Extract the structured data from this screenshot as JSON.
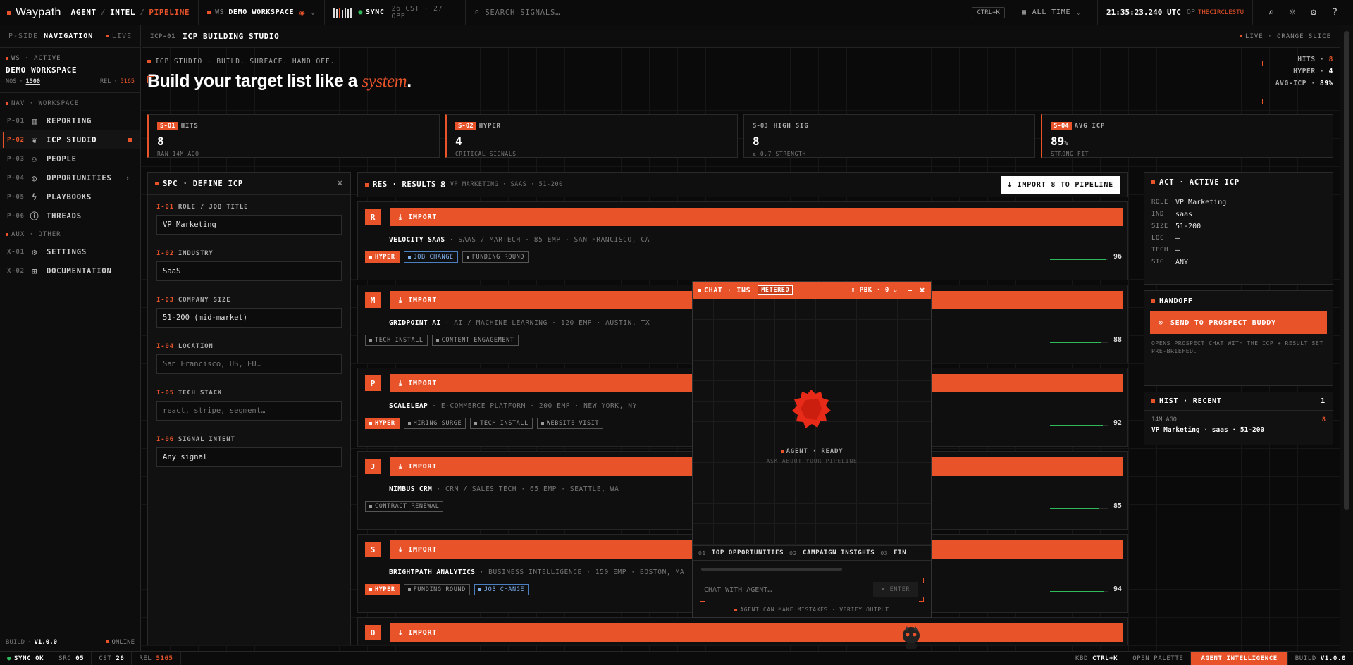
{
  "topbar": {
    "logo": "Waypath",
    "crumbs": [
      "AGENT",
      "INTEL",
      "PIPELINE"
    ],
    "workspace_prefix": "WS",
    "workspace": "DEMO WORKSPACE",
    "sync_label": "SYNC",
    "sync_stats": "26 CST · 27 OPP",
    "search_placeholder": "SEARCH SIGNALS…",
    "shortcut": "CTRL+K",
    "range": "ALL TIME",
    "clock": "21:35:23.240 UTC",
    "op_label": "OP",
    "op_user": "THECIRCLESTU"
  },
  "sidebar": {
    "head_code": "P-SIDE",
    "head_title": "NAVIGATION",
    "head_status": "LIVE",
    "ws_label": "WS · ACTIVE",
    "ws_name": "DEMO WORKSPACE",
    "nos_label": "NOS",
    "nos_value": "1500",
    "rel_label": "REL",
    "rel_value": "5165",
    "group_main": "NAV · WORKSPACE",
    "items": [
      {
        "code": "P-01",
        "label": "REPORTING",
        "icon": "bar-chart-icon"
      },
      {
        "code": "P-02",
        "label": "ICP STUDIO",
        "icon": "leaf-icon"
      },
      {
        "code": "P-03",
        "label": "PEOPLE",
        "icon": "people-icon"
      },
      {
        "code": "P-04",
        "label": "OPPORTUNITIES",
        "icon": "target-icon"
      },
      {
        "code": "P-05",
        "label": "PLAYBOOKS",
        "icon": "bolt-icon"
      },
      {
        "code": "P-06",
        "label": "THREADS",
        "icon": "info-icon"
      }
    ],
    "group_aux": "AUX · OTHER",
    "aux_items": [
      {
        "code": "X-01",
        "label": "SETTINGS",
        "icon": "gear-icon"
      },
      {
        "code": "X-02",
        "label": "DOCUMENTATION",
        "icon": "book-icon"
      }
    ],
    "build_label": "BUILD",
    "build_value": "V1.0.0",
    "online": "ONLINE"
  },
  "page": {
    "code": "ICP-01",
    "title": "ICP BUILDING STUDIO",
    "live": "LIVE · ORANGE SLICE",
    "kicker": "ICP STUDIO · BUILD. SURFACE. HAND OFF.",
    "hero_main": "Build your target list like a ",
    "hero_em": "system",
    "hero_end": ".",
    "mini": [
      {
        "k": "HITS",
        "v": "8"
      },
      {
        "k": "HYPER",
        "v": "4"
      },
      {
        "k": "AVG-ICP",
        "v": "89%"
      }
    ]
  },
  "stats": [
    {
      "code": "S-01",
      "label": "HITS",
      "value": "8",
      "sub": "RAN 14M AGO"
    },
    {
      "code": "S-02",
      "label": "HYPER",
      "value": "4",
      "sub": "CRITICAL SIGNALS"
    },
    {
      "code": "S-03",
      "label": "HIGH SIG",
      "value": "8",
      "sub": "≥ 0.7 STRENGTH"
    },
    {
      "code": "S-04",
      "label": "AVG ICP",
      "value": "89",
      "unit": "%",
      "sub": "STRONG FIT"
    }
  ],
  "define": {
    "title": "SPC · DEFINE ICP",
    "fields": [
      {
        "code": "I-01",
        "label": "ROLE / JOB TITLE",
        "value": "VP Marketing",
        "placeholder": ""
      },
      {
        "code": "I-02",
        "label": "INDUSTRY",
        "value": "SaaS",
        "placeholder": ""
      },
      {
        "code": "I-03",
        "label": "COMPANY SIZE",
        "value": "51-200 (mid-market)",
        "placeholder": ""
      },
      {
        "code": "I-04",
        "label": "LOCATION",
        "value": "",
        "placeholder": "San Francisco, US, EU…"
      },
      {
        "code": "I-05",
        "label": "TECH STACK",
        "value": "",
        "placeholder": "react, stripe, segment…"
      },
      {
        "code": "I-06",
        "label": "SIGNAL INTENT",
        "value": "Any signal",
        "placeholder": ""
      }
    ]
  },
  "results": {
    "title": "RES · RESULTS",
    "count": "8",
    "filter": "VP MARKETING · SAAS · 51-200",
    "import_all": "IMPORT 8 TO PIPELINE",
    "import_label": "IMPORT",
    "cards": [
      {
        "initial": "R",
        "name": "VELOCITY SAAS",
        "meta": "· SAAS / MARTECH · 85 EMP · SAN FRANCISCO, CA",
        "tags": [
          {
            "t": "HYPER",
            "k": "hyper"
          },
          {
            "t": "JOB CHANGE",
            "k": "blue"
          },
          {
            "t": "FUNDING ROUND",
            "k": "grey"
          }
        ],
        "score": 96
      },
      {
        "initial": "M",
        "name": "GRIDPOINT AI",
        "meta": "· AI / MACHINE LEARNING · 120 EMP · AUSTIN, TX",
        "tags": [
          {
            "t": "TECH INSTALL",
            "k": "grey"
          },
          {
            "t": "CONTENT ENGAGEMENT",
            "k": "grey"
          }
        ],
        "score": 88
      },
      {
        "initial": "P",
        "name": "SCALELEAP",
        "meta": "· E-COMMERCE PLATFORM · 200 EMP · NEW YORK, NY",
        "tags": [
          {
            "t": "HYPER",
            "k": "hyper"
          },
          {
            "t": "HIRING SURGE",
            "k": "grey"
          },
          {
            "t": "TECH INSTALL",
            "k": "grey"
          },
          {
            "t": "WEBSITE VISIT",
            "k": "grey"
          }
        ],
        "score": 92
      },
      {
        "initial": "J",
        "name": "NIMBUS CRM",
        "meta": "· CRM / SALES TECH · 65 EMP · SEATTLE, WA",
        "tags": [
          {
            "t": "CONTRACT RENEWAL",
            "k": "grey"
          }
        ],
        "score": 85
      },
      {
        "initial": "S",
        "name": "BRIGHTPATH ANALYTICS",
        "meta": "· BUSINESS INTELLIGENCE · 150 EMP · BOSTON, MA",
        "tags": [
          {
            "t": "HYPER",
            "k": "hyper"
          },
          {
            "t": "FUNDING ROUND",
            "k": "grey"
          },
          {
            "t": "JOB CHANGE",
            "k": "blue"
          }
        ],
        "score": 94
      },
      {
        "initial": "D",
        "name": "",
        "meta": "",
        "tags": [],
        "score": null
      }
    ]
  },
  "active": {
    "title": "ACT · ACTIVE ICP",
    "rows": [
      {
        "k": "ROLE",
        "v": "VP Marketing"
      },
      {
        "k": "IND",
        "v": "saas"
      },
      {
        "k": "SIZE",
        "v": "51-200"
      },
      {
        "k": "LOC",
        "v": "—"
      },
      {
        "k": "TECH",
        "v": "—"
      },
      {
        "k": "SIG",
        "v": "ANY"
      }
    ],
    "handoff_title": "HANDOFF",
    "handoff_btn": "SEND TO PROSPECT BUDDY",
    "handoff_note": "OPENS PROSPECT CHAT WITH THE ICP + RESULT SET PRE-BRIEFED.",
    "hist_title": "HIST · RECENT",
    "hist_count": "1",
    "hist_time": "14M AGO",
    "hist_hits": "8",
    "hist_query": "VP Marketing · saas · 51-200"
  },
  "chat": {
    "title": "CHAT · INS",
    "metered": "METERED",
    "pbk": "PBK · 0",
    "status": "AGENT · READY",
    "hint": "ASK ABOUT YOUR PIPELINE",
    "chips": [
      {
        "n": "01",
        "t": "TOP OPPORTUNITIES"
      },
      {
        "n": "02",
        "t": "CAMPAIGN INSIGHTS"
      },
      {
        "n": "03",
        "t": "FIN"
      }
    ],
    "placeholder": "CHAT WITH AGENT…",
    "send": "ENTER",
    "disclaimer": "AGENT CAN MAKE MISTAKES · VERIFY OUTPUT"
  },
  "status": {
    "sync": "SYNC OK",
    "src_label": "SRC",
    "src": "05",
    "cst_label": "CST",
    "cst": "26",
    "rel_label": "REL",
    "rel": "5165",
    "kbd_label": "KBD",
    "kbd": "CTRL+K",
    "palette": "OPEN PALETTE",
    "agent": "AGENT INTELLIGENCE",
    "build_label": "BUILD",
    "build": "V1.0.0"
  },
  "colors": {
    "accent": "#e8532a",
    "success": "#2fb95a",
    "info": "#4c7fbf"
  }
}
